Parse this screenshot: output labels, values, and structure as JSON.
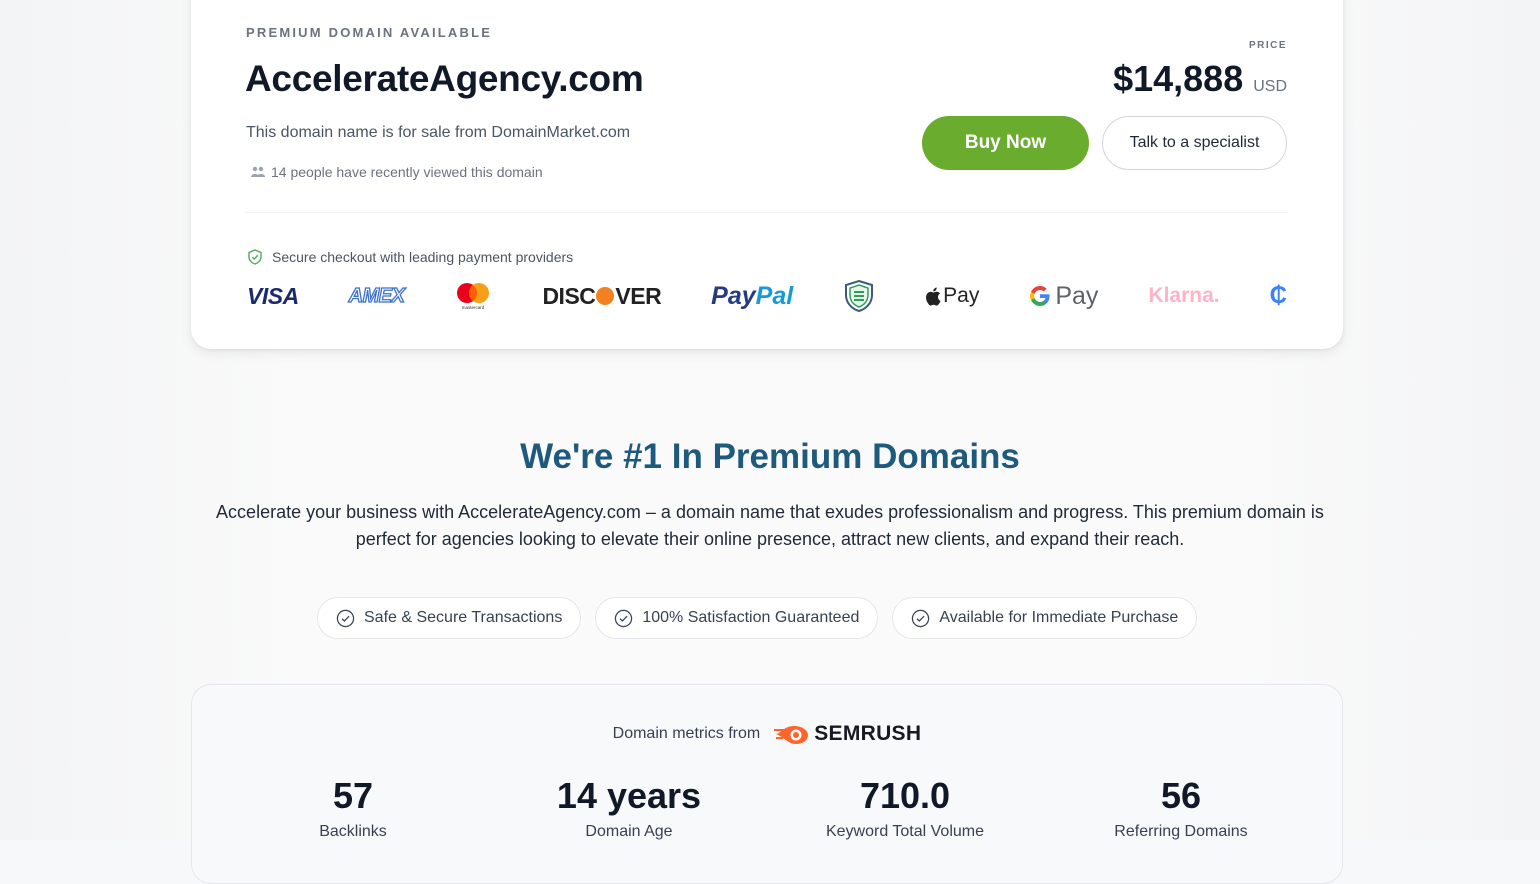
{
  "listing": {
    "eyebrow": "PREMIUM DOMAIN AVAILABLE",
    "domain": "AccelerateAgency.com",
    "subtitle": "This domain name is for sale from DomainMarket.com",
    "viewers": "14 people have recently viewed this domain",
    "price_label": "PRICE",
    "price": "$14,888",
    "currency": "USD",
    "buy_label": "Buy Now",
    "talk_label": "Talk to a specialist",
    "secure_text": "Secure checkout with leading payment providers"
  },
  "payments": {
    "visa": "VISA",
    "amex": "AMEX",
    "mastercard_caption": "mastercard",
    "discover_a": "DISC",
    "discover_b": "VER",
    "paypal_a": "Pay",
    "paypal_b": "Pal",
    "applepay": "Pay",
    "gpay": "Pay",
    "klarna": "Klarna.",
    "coin": "₵"
  },
  "promo": {
    "headline": "We're #1 In Premium Domains",
    "description": "Accelerate your business with AccelerateAgency.com – a domain name that exudes professionalism and progress. This premium domain is perfect for agencies looking to elevate their online presence, attract new clients, and expand their reach.",
    "badges": [
      "Safe & Secure Transactions",
      "100% Satisfaction Guaranteed",
      "Available for Immediate Purchase"
    ]
  },
  "metrics": {
    "from_label": "Domain metrics from",
    "provider": "SEMRUSH",
    "items": [
      {
        "value": "57",
        "label": "Backlinks"
      },
      {
        "value": "14 years",
        "label": "Domain Age"
      },
      {
        "value": "710.0",
        "label": "Keyword Total Volume"
      },
      {
        "value": "56",
        "label": "Referring Domains"
      }
    ]
  },
  "colors": {
    "accent_green": "#6aac2e",
    "headline_blue": "#1e5a7d",
    "semrush_orange": "#ff642d"
  }
}
